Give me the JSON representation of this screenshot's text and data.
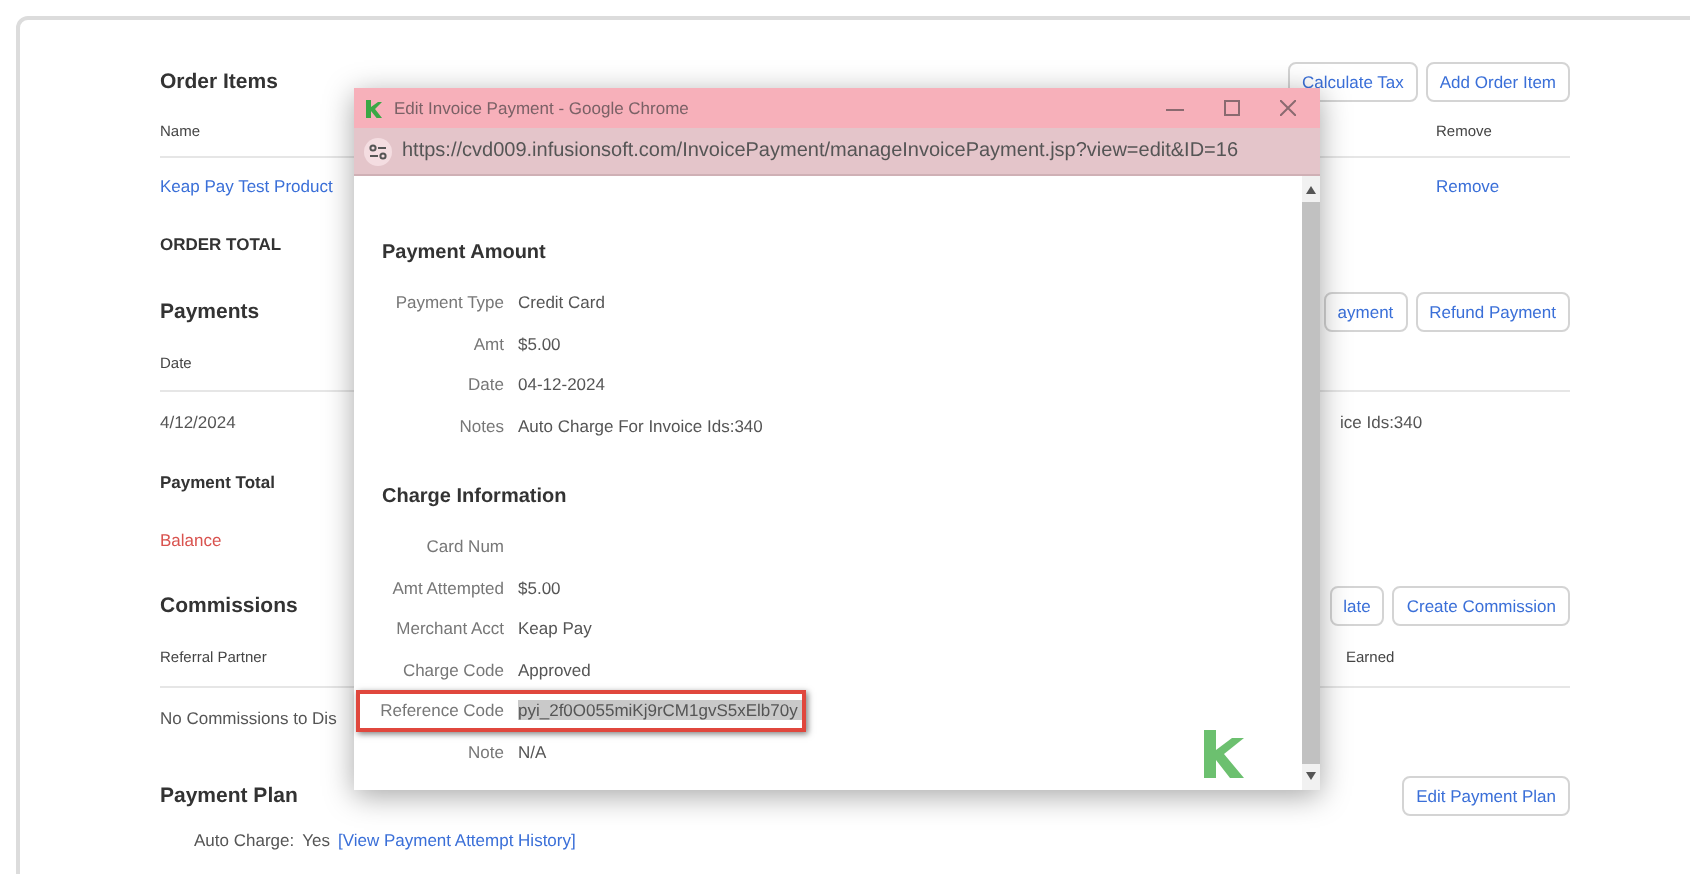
{
  "order_items": {
    "title": "Order Items",
    "buttons": [
      "Calculate Tax",
      "Add Order Item"
    ],
    "columns": {
      "name": "Name",
      "remove": "Remove"
    },
    "rows": [
      {
        "name": "Keap Pay Test Product",
        "action": "Remove"
      }
    ],
    "total_label": "ORDER TOTAL"
  },
  "payments": {
    "title": "Payments",
    "buttons": [
      "ayment",
      "Refund Payment"
    ],
    "columns": {
      "date": "Date"
    },
    "rows": [
      {
        "date": "4/12/2024",
        "notes": "ice Ids:340"
      }
    ],
    "total_label": "Payment Total",
    "balance_label": "Balance"
  },
  "commissions": {
    "title": "Commissions",
    "buttons": [
      "late",
      "Create Commission"
    ],
    "columns": {
      "referral_partner": "Referral Partner",
      "earned": "Earned"
    },
    "empty_text": "No Commissions to Dis"
  },
  "payment_plan": {
    "title": "Payment Plan",
    "buttons": [
      "Edit Payment Plan"
    ],
    "auto_charge_label": "Auto Charge:",
    "auto_charge_value": "Yes",
    "history_link": "[View Payment Attempt History]"
  },
  "popup": {
    "title": "Edit Invoice Payment - Google Chrome",
    "url": "https://cvd009.infusionsoft.com/InvoicePayment/manageInvoicePayment.jsp?view=edit&ID=16",
    "sections": [
      {
        "title": "Payment Amount",
        "fields": [
          {
            "label": "Payment Type",
            "value": "Credit Card",
            "selected": false,
            "outlined": false
          },
          {
            "label": "Amt",
            "value": "$5.00",
            "selected": false,
            "outlined": false
          },
          {
            "label": "Date",
            "value": "04-12-2024",
            "selected": false,
            "outlined": false
          },
          {
            "label": "Notes",
            "value": "Auto Charge For Invoice Ids:340",
            "selected": false,
            "outlined": false
          }
        ]
      },
      {
        "title": "Charge Information",
        "fields": [
          {
            "label": "Card Num",
            "selected": false,
            "outlined": false
          },
          {
            "label": "Amt Attempted",
            "value": "$5.00",
            "selected": false,
            "outlined": false
          },
          {
            "label": "Merchant Acct",
            "value": "Keap Pay",
            "selected": false,
            "outlined": false
          },
          {
            "label": "Charge Code",
            "value": "Approved",
            "selected": false,
            "outlined": false
          },
          {
            "label": "Reference Code",
            "value": "pyi_2f0O055miKj9rCM1gvS5xElb70y",
            "selected": true,
            "outlined": true
          },
          {
            "label": "Note",
            "value": "N/A",
            "selected": false,
            "outlined": false
          }
        ]
      }
    ]
  }
}
